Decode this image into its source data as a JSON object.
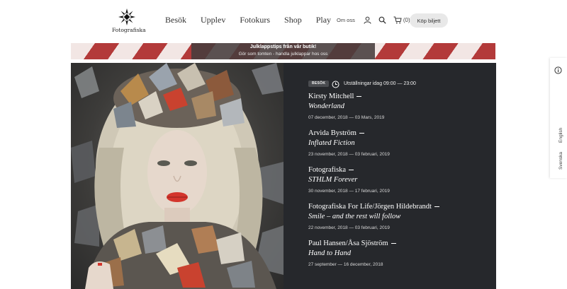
{
  "header": {
    "logo_text": "Fotografiska",
    "nav": [
      "Besök",
      "Upplev",
      "Fotokurs",
      "Shop",
      "Play"
    ],
    "about_label": "Om oss",
    "cart_count": "(0)",
    "buy_ticket_label": "Köp biljett",
    "icons": [
      "user-icon",
      "search-icon",
      "cart-icon"
    ]
  },
  "banner": {
    "title": "Julklappstips från vår butik!",
    "subtitle": "Gör som tomten - handla julklappar hos oss",
    "colors": [
      "#b33a3a",
      "#f2e6e4"
    ]
  },
  "exhibitions_panel": {
    "badge": "BESÖK",
    "hours": "Utställningar idag 09:00 — 23:00",
    "items": [
      {
        "artist": "Kirsty Mitchell",
        "title": "Wonderland",
        "dates": "07 december, 2018 — 03 Mars, 2019"
      },
      {
        "artist": "Arvida Byström",
        "title": "Inflated Fiction",
        "dates": "23 november, 2018 — 03 februari, 2019"
      },
      {
        "artist": "Fotografiska",
        "title": "STHLM Forever",
        "dates": "30 november, 2018 — 17 februari, 2019"
      },
      {
        "artist": "Fotografiska For Life/Jörgen Hildebrandt",
        "title": "Smile – and the rest will follow",
        "dates": "22 november, 2018 — 03 februari, 2019"
      },
      {
        "artist": "Paul Hansen/Åsa Sjöström",
        "title": "Hand to Hand",
        "dates": "27 september — 16 december, 2018"
      }
    ],
    "background": "#26282c"
  },
  "side_tab": {
    "languages": [
      "English",
      "Svenska"
    ],
    "icon": "info-icon"
  }
}
